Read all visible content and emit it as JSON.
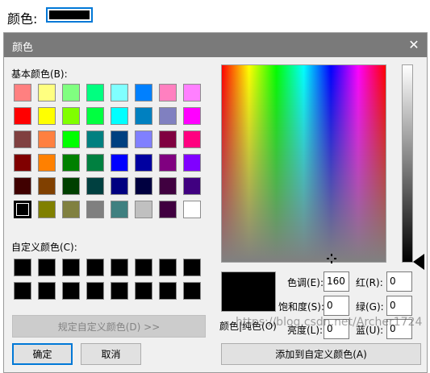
{
  "top": {
    "label": "颜色:",
    "color": "#000000"
  },
  "dialog": {
    "title": "颜色",
    "close_icon": "close-icon",
    "basic_colors_label": "基本颜色(B):",
    "basic_colors": [
      [
        "#ff8080",
        "#ffff80",
        "#80ff80",
        "#00ff80",
        "#80ffff",
        "#0080ff",
        "#ff80c0",
        "#ff80ff"
      ],
      [
        "#ff0000",
        "#ffff00",
        "#80ff00",
        "#00ff40",
        "#00ffff",
        "#0080c0",
        "#8080c0",
        "#ff00ff"
      ],
      [
        "#804040",
        "#ff8040",
        "#00ff00",
        "#008080",
        "#004080",
        "#8080ff",
        "#800040",
        "#ff0080"
      ],
      [
        "#800000",
        "#ff8000",
        "#008000",
        "#008040",
        "#0000ff",
        "#0000a0",
        "#800080",
        "#8000ff"
      ],
      [
        "#400000",
        "#804000",
        "#004000",
        "#004040",
        "#000080",
        "#000040",
        "#400040",
        "#400080"
      ],
      [
        "#000000",
        "#808000",
        "#808040",
        "#808080",
        "#408080",
        "#c0c0c0",
        "#400040",
        "#ffffff"
      ]
    ],
    "custom_colors_label": "自定义颜色(C):",
    "custom_colors": [
      [
        "#000000",
        "#000000",
        "#000000",
        "#000000",
        "#000000",
        "#000000",
        "#000000",
        "#000000"
      ],
      [
        "#000000",
        "#000000",
        "#000000",
        "#000000",
        "#000000",
        "#000000",
        "#000000",
        "#000000"
      ]
    ],
    "define_custom_button": "规定自定义颜色(D) >>",
    "ok_button": "确定",
    "cancel_button": "取消",
    "preview_label": "颜色|纯色(O)",
    "fields": {
      "hue_label": "色调(E):",
      "hue": "160",
      "sat_label": "饱和度(S):",
      "sat": "0",
      "lum_label": "亮度(L):",
      "lum": "0",
      "red_label": "红(R):",
      "red": "0",
      "green_label": "绿(G):",
      "green": "0",
      "blue_label": "蓝(U):",
      "blue": "0"
    },
    "add_custom_button": "添加到自定义颜色(A)",
    "watermark": "https://blog.csdn.net/Archer1724"
  }
}
